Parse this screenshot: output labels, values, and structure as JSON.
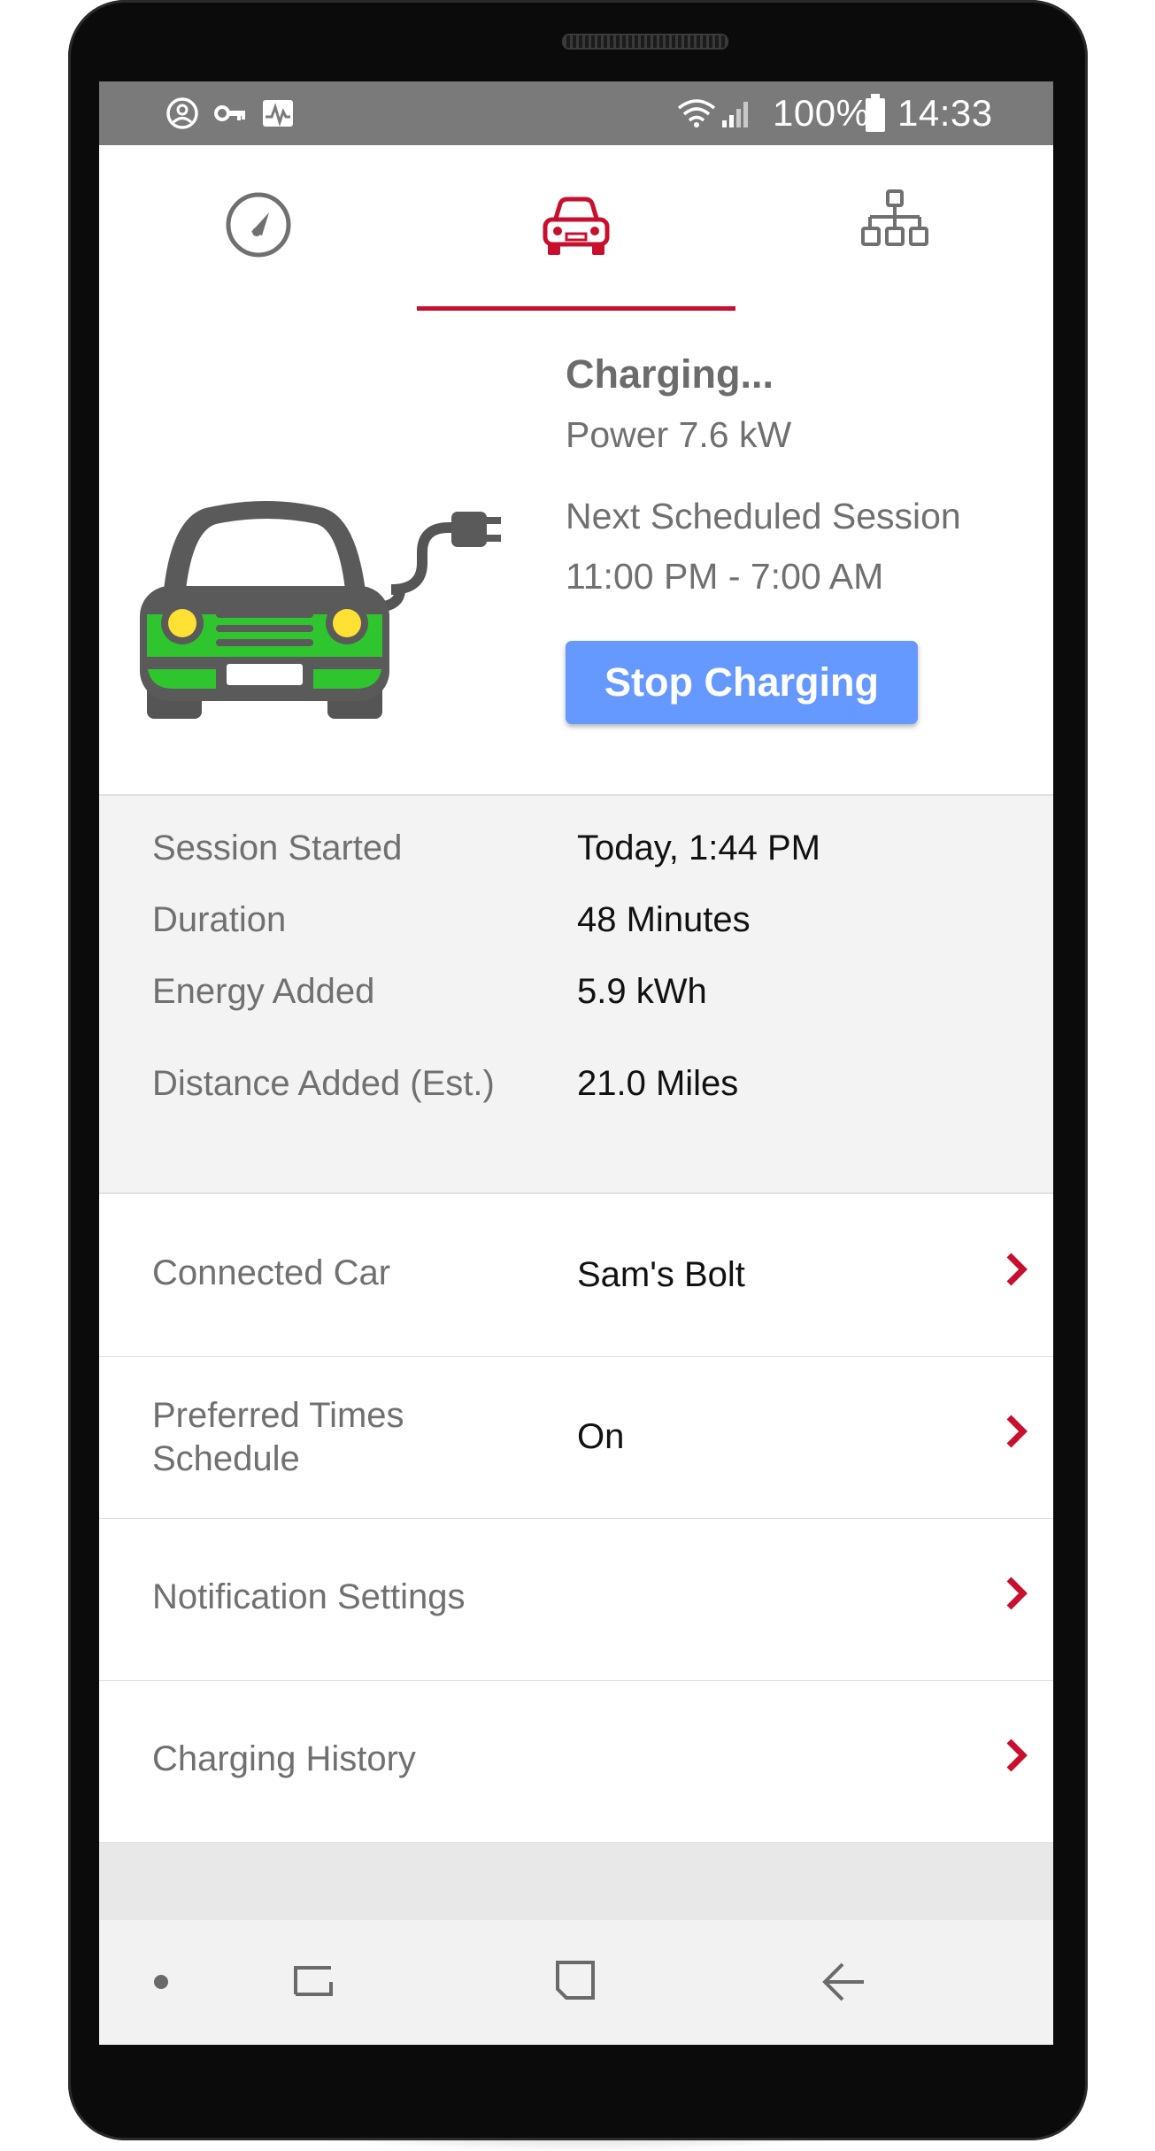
{
  "status_bar": {
    "battery": "100%",
    "time": "14:33"
  },
  "tabs": [
    {
      "icon": "speedometer-icon",
      "active": false
    },
    {
      "icon": "car-icon",
      "active": true
    },
    {
      "icon": "network-icon",
      "active": false
    }
  ],
  "hero": {
    "status": "Charging...",
    "power": "Power 7.6 kW",
    "next_label": "Next Scheduled Session",
    "next_time": "11:00 PM - 7:00 AM",
    "stop_label": "Stop Charging"
  },
  "stats": [
    {
      "label": "Session Started",
      "value": "Today, 1:44 PM"
    },
    {
      "label": "Duration",
      "value": "48 Minutes"
    },
    {
      "label": "Energy Added",
      "value": "5.9 kWh"
    },
    {
      "label": "Distance Added (Est.)",
      "value": "21.0 Miles"
    }
  ],
  "menu": [
    {
      "label": "Connected Car",
      "value": "Sam's Bolt"
    },
    {
      "label_line1": "Preferred Times",
      "label_line2": "Schedule",
      "value": "On"
    },
    {
      "label": "Notification Settings",
      "value": ""
    },
    {
      "label": "Charging History",
      "value": ""
    }
  ],
  "colors": {
    "accent": "#c8102e",
    "button": "#6699ff",
    "status_bar": "#7a7a7a",
    "car_green": "#2ec52e"
  }
}
